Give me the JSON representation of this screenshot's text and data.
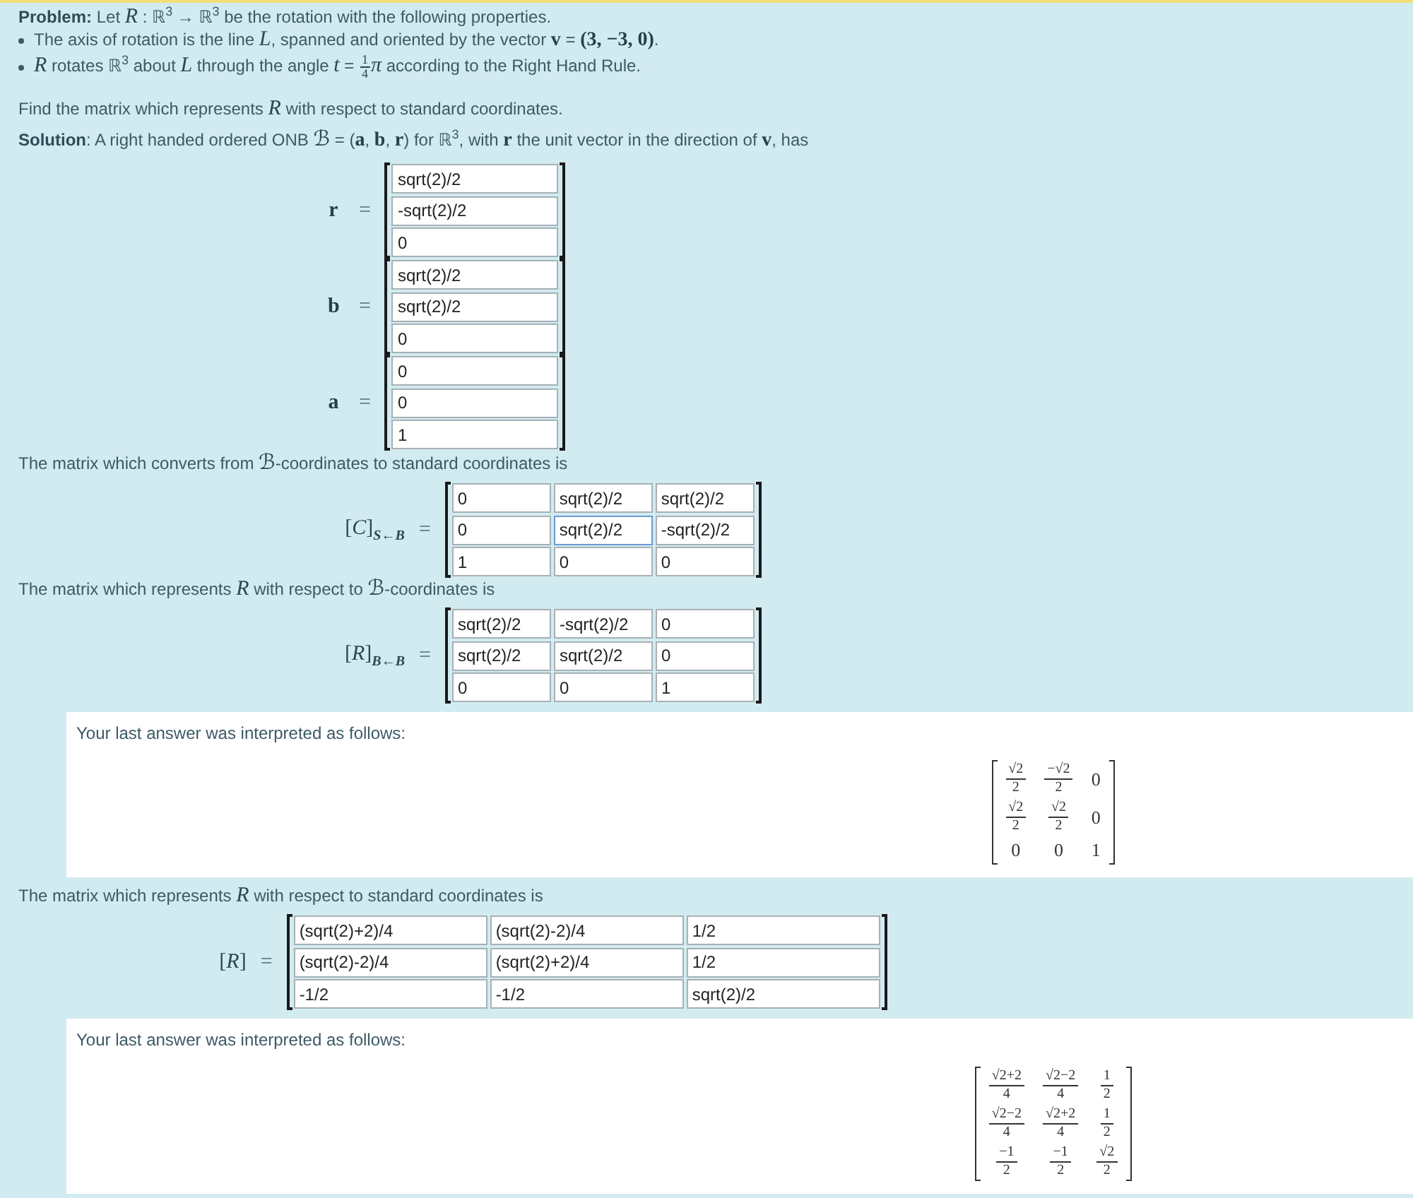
{
  "problem": {
    "lead": "Problem:",
    "text": "Let *R* : ℝ$^{3}$ → ℝ$^{3}$ be the rotation with the following properties.",
    "properties": [
      {
        "kind": "text",
        "text": "The axis of rotation is the line *L*, spanned and oriented by the vector **v** = **(3, −3, 0)**."
      },
      {
        "kind": "fraction",
        "before": "*R* rotates ℝ$^{3}$ about *L* through the angle *t* =",
        "numerator": "1",
        "denominator": "4",
        "after": "*π* according to the Right Hand Rule."
      }
    ],
    "task": "Find the matrix which represents *R* with respect to standard coordinates."
  },
  "solution": {
    "lead": "Solution",
    "text": ": A right handed ordered ONB *ℬ* = (**a**, **b**, **r**) for ℝ$^{3}$, with **r** the unit vector in the direction of **v**, has",
    "vectors": [
      {
        "name": "r",
        "sign": "=",
        "entries": [
          "sqrt(2)/2",
          "-sqrt(2)/2",
          "0"
        ]
      },
      {
        "name": "b",
        "sign": "=",
        "entries": [
          "sqrt(2)/2",
          "sqrt(2)/2",
          "0"
        ]
      },
      {
        "name": "a",
        "sign": "=",
        "entries": [
          "0",
          "0",
          "1"
        ]
      }
    ],
    "steps": [
      {
        "text": "The matrix which converts from *ℬ*-coordinates to standard coordinates is",
        "matrix": {
          "label": "[*C*]",
          "subscript": "S←B",
          "sign": "=",
          "rows": [
            [
              {
                "value": "0",
                "focused": false
              },
              {
                "value": "sqrt(2)/2",
                "focused": false
              },
              {
                "value": "sqrt(2)/2",
                "focused": false
              }
            ],
            [
              {
                "value": "0",
                "focused": false
              },
              {
                "value": "sqrt(2)/2",
                "focused": true
              },
              {
                "value": "-sqrt(2)/2",
                "focused": false
              }
            ],
            [
              {
                "value": "1",
                "focused": false
              },
              {
                "value": "0",
                "focused": false
              },
              {
                "value": "0",
                "focused": false
              }
            ]
          ]
        }
      },
      {
        "text": "The matrix which represents *R* with respect to *ℬ*-coordinates is",
        "matrix": {
          "label": "[*R*]",
          "subscript": "B←B",
          "sign": "=",
          "rows": [
            [
              "sqrt(2)/2",
              "-sqrt(2)/2",
              "0"
            ],
            [
              "sqrt(2)/2",
              "sqrt(2)/2",
              "0"
            ],
            [
              "0",
              "0",
              "1"
            ]
          ]
        },
        "interpretation": {
          "text": "Your last answer was interpreted as follows:",
          "rows": [
            [
              {
                "kind": "fraction",
                "numerator": "√2",
                "denominator": "2"
              },
              {
                "kind": "fraction",
                "numerator": "−√2",
                "denominator": "2"
              },
              {
                "kind": "number",
                "text": "0"
              }
            ],
            [
              {
                "kind": "fraction",
                "numerator": "√2",
                "denominator": "2"
              },
              {
                "kind": "fraction",
                "numerator": "√2",
                "denominator": "2"
              },
              {
                "kind": "number",
                "text": "0"
              }
            ],
            [
              {
                "kind": "number",
                "text": "0"
              },
              {
                "kind": "number",
                "text": "0"
              },
              {
                "kind": "number",
                "text": "1"
              }
            ]
          ]
        }
      },
      {
        "text": "The matrix which represents *R* with respect to standard coordinates is",
        "matrix": {
          "label": "[*R*]",
          "sign": "=",
          "rows": [
            [
              "(sqrt(2)+2)/4",
              "(sqrt(2)-2)/4",
              "1/2"
            ],
            [
              "(sqrt(2)-2)/4",
              "(sqrt(2)+2)/4",
              "1/2"
            ],
            [
              "-1/2",
              "-1/2",
              "sqrt(2)/2"
            ]
          ]
        },
        "interpretation": {
          "text": "Your last answer was interpreted as follows:",
          "rows": [
            [
              {
                "kind": "fraction",
                "numerator": "√2+2",
                "denominator": "4"
              },
              {
                "kind": "fraction",
                "numerator": "√2−2",
                "denominator": "4"
              },
              {
                "kind": "fraction",
                "numerator": "1",
                "denominator": "2"
              }
            ],
            [
              {
                "kind": "fraction",
                "numerator": "√2−2",
                "denominator": "4"
              },
              {
                "kind": "fraction",
                "numerator": "√2+2",
                "denominator": "4"
              },
              {
                "kind": "fraction",
                "numerator": "1",
                "denominator": "2"
              }
            ],
            [
              {
                "kind": "fraction",
                "numerator": "−1",
                "denominator": "2"
              },
              {
                "kind": "fraction",
                "numerator": "−1",
                "denominator": "2"
              },
              {
                "kind": "fraction",
                "numerator": "√2",
                "denominator": "2"
              }
            ]
          ]
        }
      }
    ]
  }
}
